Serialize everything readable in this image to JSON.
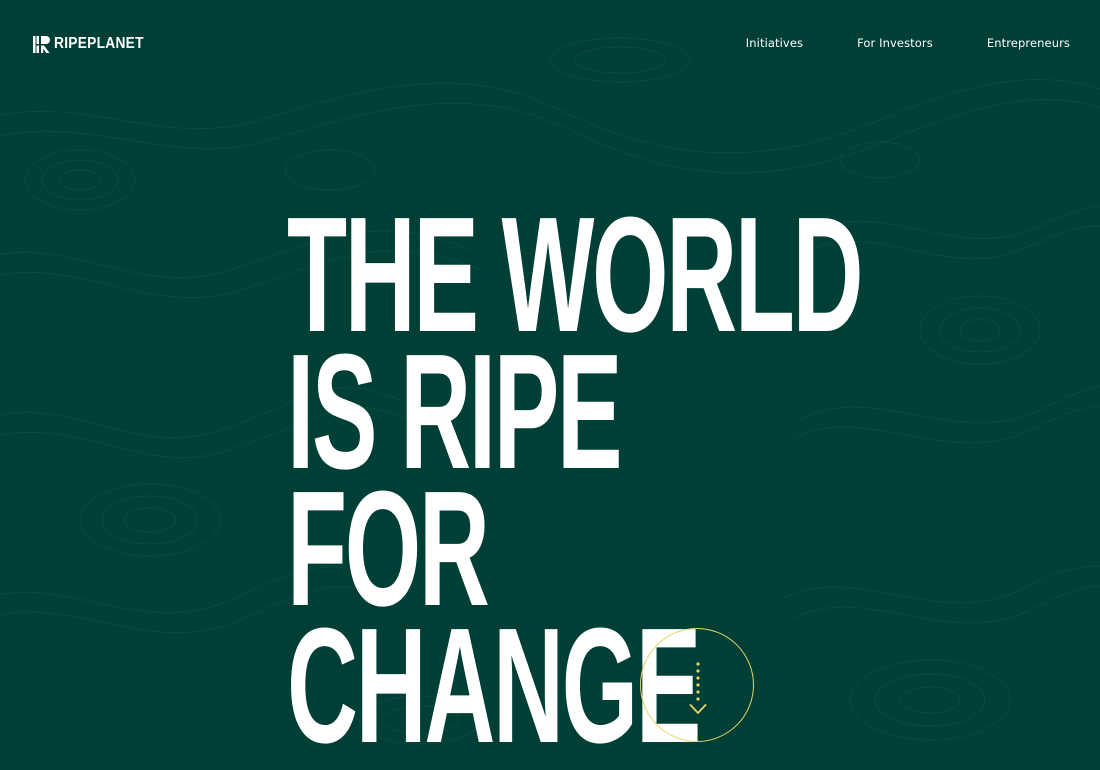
{
  "brand": {
    "name": "RIPEPLANET",
    "logo_icon": "ripeplanet-logo-mark-icon"
  },
  "nav": {
    "items": [
      {
        "label": "Initiatives"
      },
      {
        "label": "For Investors"
      },
      {
        "label": "Entrepreneurs"
      }
    ]
  },
  "hero": {
    "lines": [
      "THE WORLD",
      "IS RIPE",
      "FOR",
      "CHANGE"
    ]
  },
  "scroll_button": {
    "icon": "arrow-down-icon"
  },
  "colors": {
    "background": "#003f35",
    "text": "#ffffff",
    "accent": "#e6d36a"
  }
}
